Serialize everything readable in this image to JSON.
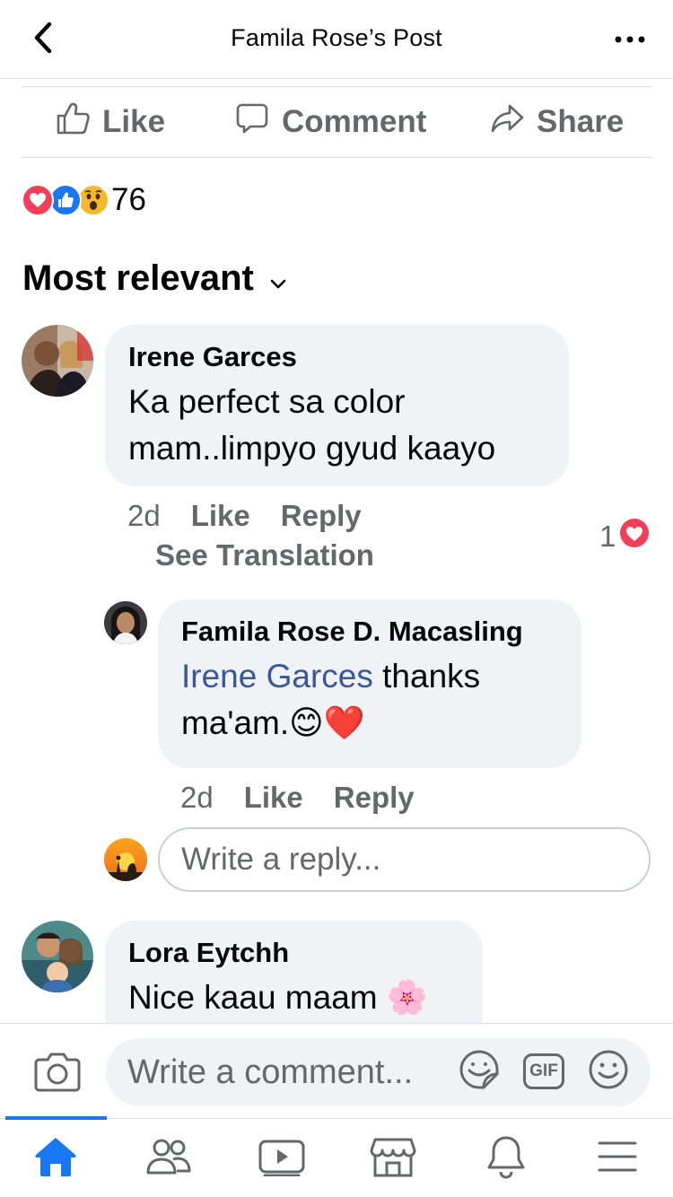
{
  "header": {
    "title": "Famila Rose’s Post"
  },
  "actions": {
    "like": "Like",
    "comment": "Comment",
    "share": "Share"
  },
  "reactions": {
    "count": "76",
    "types": [
      "love-icon",
      "like-icon",
      "wow-icon"
    ]
  },
  "sort": {
    "label": "Most relevant"
  },
  "comments": [
    {
      "author": "Irene Garces",
      "text": "Ka perfect sa color mam..limpyo gyud kaayo",
      "time": "2d",
      "like": "Like",
      "reply": "Reply",
      "see_translation": "See Translation",
      "reaction_count": "1",
      "replies": [
        {
          "author": "Famila Rose D. Macasling",
          "mention": "Irene Garces",
          "text": " thanks ma'am.",
          "emoji": "😊❤️",
          "time": "2d",
          "like": "Like",
          "reply": "Reply"
        }
      ]
    },
    {
      "author": "Lora Eytchh",
      "text": "Nice kaau maam 🌸"
    }
  ],
  "reply_input": {
    "placeholder": "Write a reply..."
  },
  "composer": {
    "placeholder": "Write a comment...",
    "gif_label": "GIF"
  },
  "colors": {
    "accent": "#1877f2",
    "secondary_text": "#65676b",
    "bubble": "#f0f2f5",
    "mention": "#385898",
    "love": "#f33e58"
  }
}
